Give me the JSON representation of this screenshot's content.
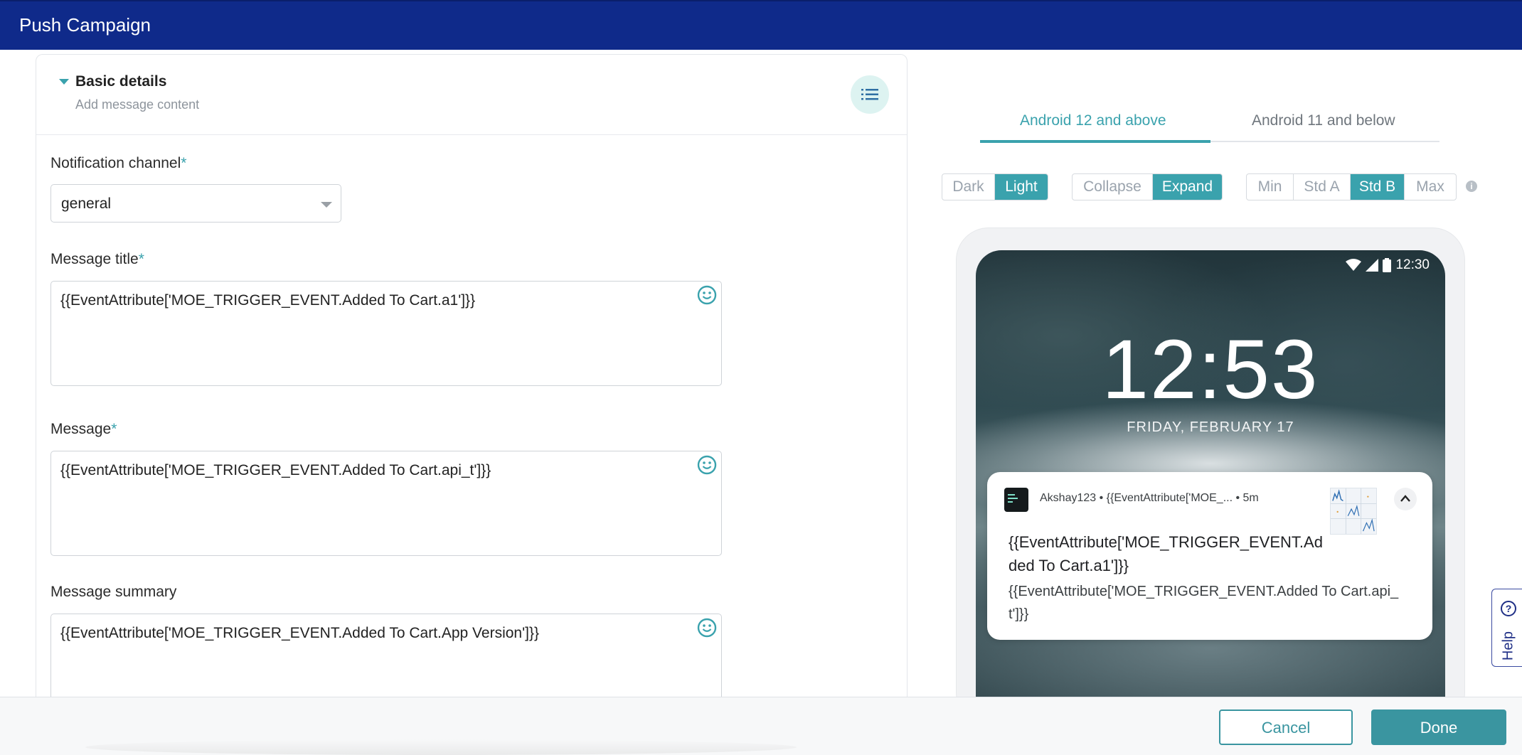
{
  "window": {
    "title": "Push Campaign"
  },
  "section": {
    "title": "Basic details",
    "subtitle": "Add message content"
  },
  "form": {
    "channel": {
      "label": "Notification channel",
      "required_mark": "*",
      "value": "general"
    },
    "title": {
      "label": "Message title",
      "required_mark": "*",
      "value": "{{EventAttribute['MOE_TRIGGER_EVENT.Added To Cart.a1']}}"
    },
    "message": {
      "label": "Message",
      "required_mark": "*",
      "value": "{{EventAttribute['MOE_TRIGGER_EVENT.Added To Cart.api_t']}}"
    },
    "summary": {
      "label": "Message summary",
      "value": "{{EventAttribute['MOE_TRIGGER_EVENT.Added To Cart.App Version']}}"
    }
  },
  "preview": {
    "tabs": [
      {
        "label": "Android 12 and above",
        "active": true
      },
      {
        "label": "Android 11 and below",
        "active": false
      }
    ],
    "theme": {
      "options": [
        "Dark",
        "Light"
      ],
      "selected": "Light"
    },
    "view": {
      "options": [
        "Collapse",
        "Expand"
      ],
      "selected": "Expand"
    },
    "style": {
      "options": [
        "Min",
        "Std A",
        "Std B",
        "Max"
      ],
      "selected": "Std B"
    },
    "info_icon": "info-icon",
    "phone": {
      "status_time": "12:30",
      "clock": "12:53",
      "date": "FRIDAY, FEBRUARY 17",
      "notification": {
        "meta": "Akshay123 • {{EventAttribute['MOE_... • 5m",
        "title": "{{EventAttribute['MOE_TRIGGER_EVENT.Added To Cart.a1']}}",
        "body": "{{EventAttribute['MOE_TRIGGER_EVENT.Added To Cart.api_t']}}"
      }
    }
  },
  "help": {
    "label": "Help"
  },
  "footer": {
    "cancel": "Cancel",
    "done": "Done"
  },
  "colors": {
    "header": "#0f2a8a",
    "accent": "#3aa2ad",
    "button": "#3a95a0"
  }
}
